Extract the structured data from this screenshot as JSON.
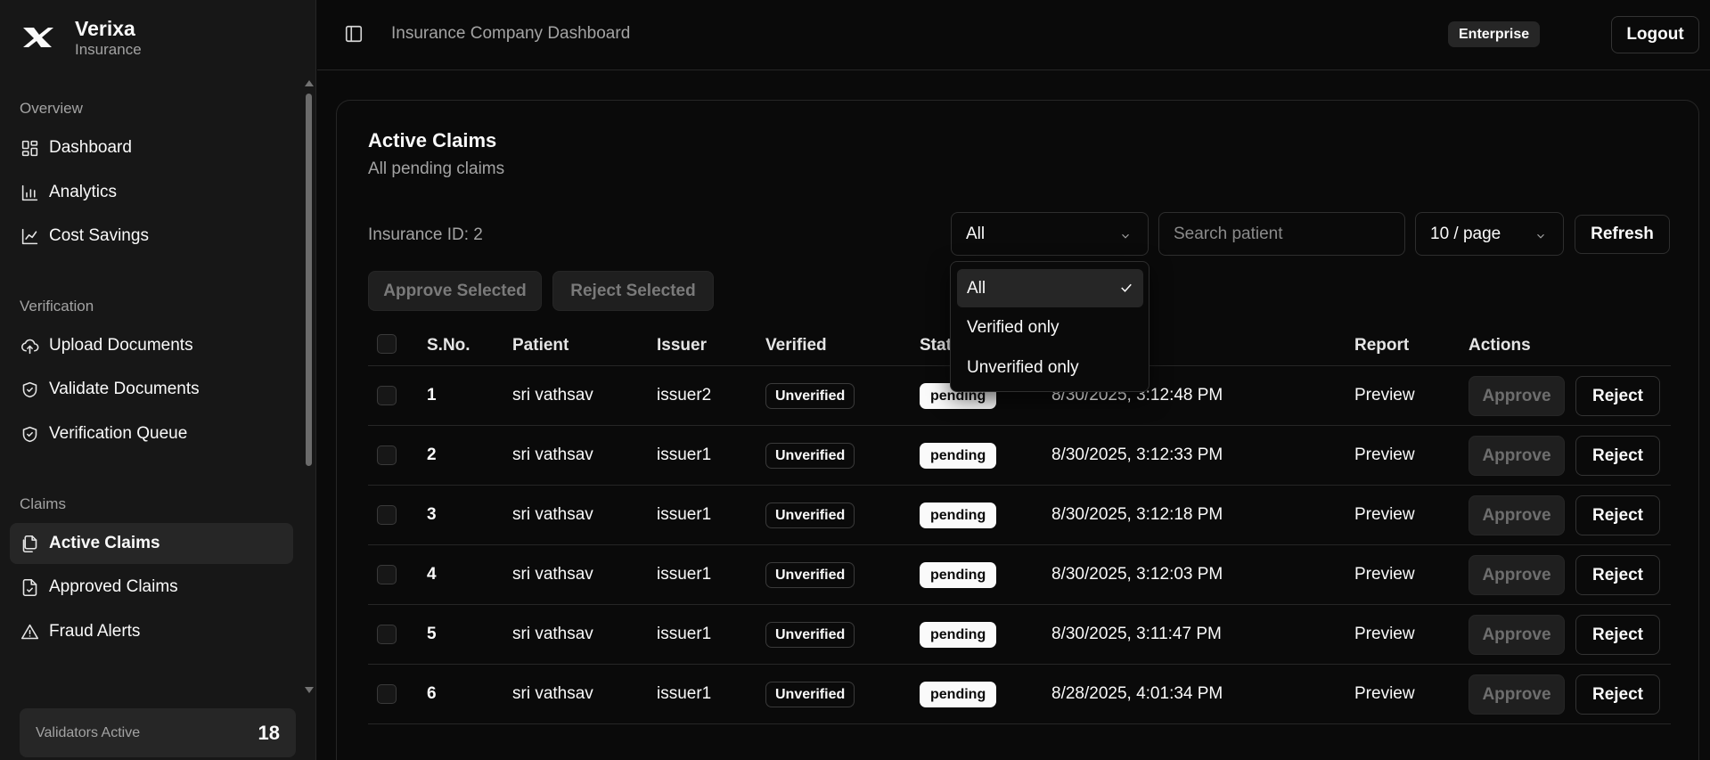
{
  "brand": {
    "name": "Verixa",
    "subtitle": "Insurance"
  },
  "sidebar": {
    "groups": [
      {
        "label": "Overview",
        "items": [
          {
            "label": "Dashboard",
            "icon": "dashboard-icon"
          },
          {
            "label": "Analytics",
            "icon": "bar-chart-icon"
          },
          {
            "label": "Cost Savings",
            "icon": "line-chart-icon"
          }
        ]
      },
      {
        "label": "Verification",
        "items": [
          {
            "label": "Upload Documents",
            "icon": "cloud-upload-icon"
          },
          {
            "label": "Validate Documents",
            "icon": "shield-check-icon"
          },
          {
            "label": "Verification Queue",
            "icon": "shield-check-icon"
          }
        ]
      },
      {
        "label": "Claims",
        "items": [
          {
            "label": "Active Claims",
            "icon": "files-icon",
            "active": true
          },
          {
            "label": "Approved Claims",
            "icon": "file-check-icon"
          },
          {
            "label": "Fraud Alerts",
            "icon": "alert-triangle-icon"
          }
        ]
      }
    ],
    "validators": {
      "label": "Validators Active",
      "value": "18"
    }
  },
  "topbar": {
    "title": "Insurance Company Dashboard",
    "plan_badge": "Enterprise",
    "logout_label": "Logout"
  },
  "card": {
    "title": "Active Claims",
    "subtitle": "All pending claims",
    "insurance_id": "Insurance ID: 2",
    "filter": {
      "selected": "All",
      "options": [
        "All",
        "Verified only",
        "Unverified only"
      ]
    },
    "search": {
      "placeholder": "Search patient",
      "value": ""
    },
    "page_size": "10 / page",
    "refresh_label": "Refresh",
    "approve_selected_label": "Approve Selected",
    "reject_selected_label": "Reject Selected"
  },
  "table": {
    "headers": {
      "sno": "S.No.",
      "patient": "Patient",
      "issuer": "Issuer",
      "verified": "Verified",
      "status": "Stat",
      "report": "Report",
      "actions": "Actions"
    },
    "rows": [
      {
        "sno": "1",
        "patient": "sri vathsav",
        "issuer": "issuer2",
        "verified": "Unverified",
        "status": "pending",
        "date": "8/30/2025, 3:12:48 PM",
        "report": "Preview",
        "approve": "Approve",
        "reject": "Reject"
      },
      {
        "sno": "2",
        "patient": "sri vathsav",
        "issuer": "issuer1",
        "verified": "Unverified",
        "status": "pending",
        "date": "8/30/2025, 3:12:33 PM",
        "report": "Preview",
        "approve": "Approve",
        "reject": "Reject"
      },
      {
        "sno": "3",
        "patient": "sri vathsav",
        "issuer": "issuer1",
        "verified": "Unverified",
        "status": "pending",
        "date": "8/30/2025, 3:12:18 PM",
        "report": "Preview",
        "approve": "Approve",
        "reject": "Reject"
      },
      {
        "sno": "4",
        "patient": "sri vathsav",
        "issuer": "issuer1",
        "verified": "Unverified",
        "status": "pending",
        "date": "8/30/2025, 3:12:03 PM",
        "report": "Preview",
        "approve": "Approve",
        "reject": "Reject"
      },
      {
        "sno": "5",
        "patient": "sri vathsav",
        "issuer": "issuer1",
        "verified": "Unverified",
        "status": "pending",
        "date": "8/30/2025, 3:11:47 PM",
        "report": "Preview",
        "approve": "Approve",
        "reject": "Reject"
      },
      {
        "sno": "6",
        "patient": "sri vathsav",
        "issuer": "issuer1",
        "verified": "Unverified",
        "status": "pending",
        "date": "8/28/2025, 4:01:34 PM",
        "report": "Preview",
        "approve": "Approve",
        "reject": "Reject"
      }
    ]
  }
}
